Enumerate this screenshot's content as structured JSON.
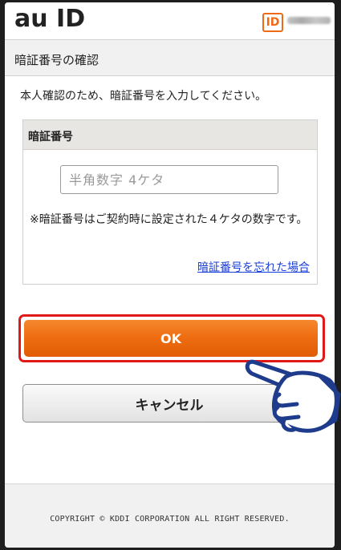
{
  "header": {
    "logo_text": "au ID",
    "id_badge": "ID"
  },
  "page_title": "暗証番号の確認",
  "instruction": "本人確認のため、暗証番号を入力してください。",
  "pin_section": {
    "heading": "暗証番号",
    "input_placeholder": "半角数字 4ケタ",
    "input_value": "",
    "note": "※暗証番号はご契約時に設定された４ケタの数字です。",
    "forgot_link": "暗証番号を忘れた場合"
  },
  "buttons": {
    "ok_label": "OK",
    "cancel_label": "キャンセル"
  },
  "footer": {
    "copyright": "COPYRIGHT © KDDI CORPORATION ALL RIGHT RESERVED."
  },
  "colors": {
    "accent_orange": "#ef6e12",
    "highlight_red": "#e01818",
    "link_blue": "#1a3fd8",
    "hand_outline": "#1f3c8c"
  },
  "icons": {
    "pointing_hand": "pointing-hand-icon",
    "id_badge": "id-badge-icon"
  }
}
